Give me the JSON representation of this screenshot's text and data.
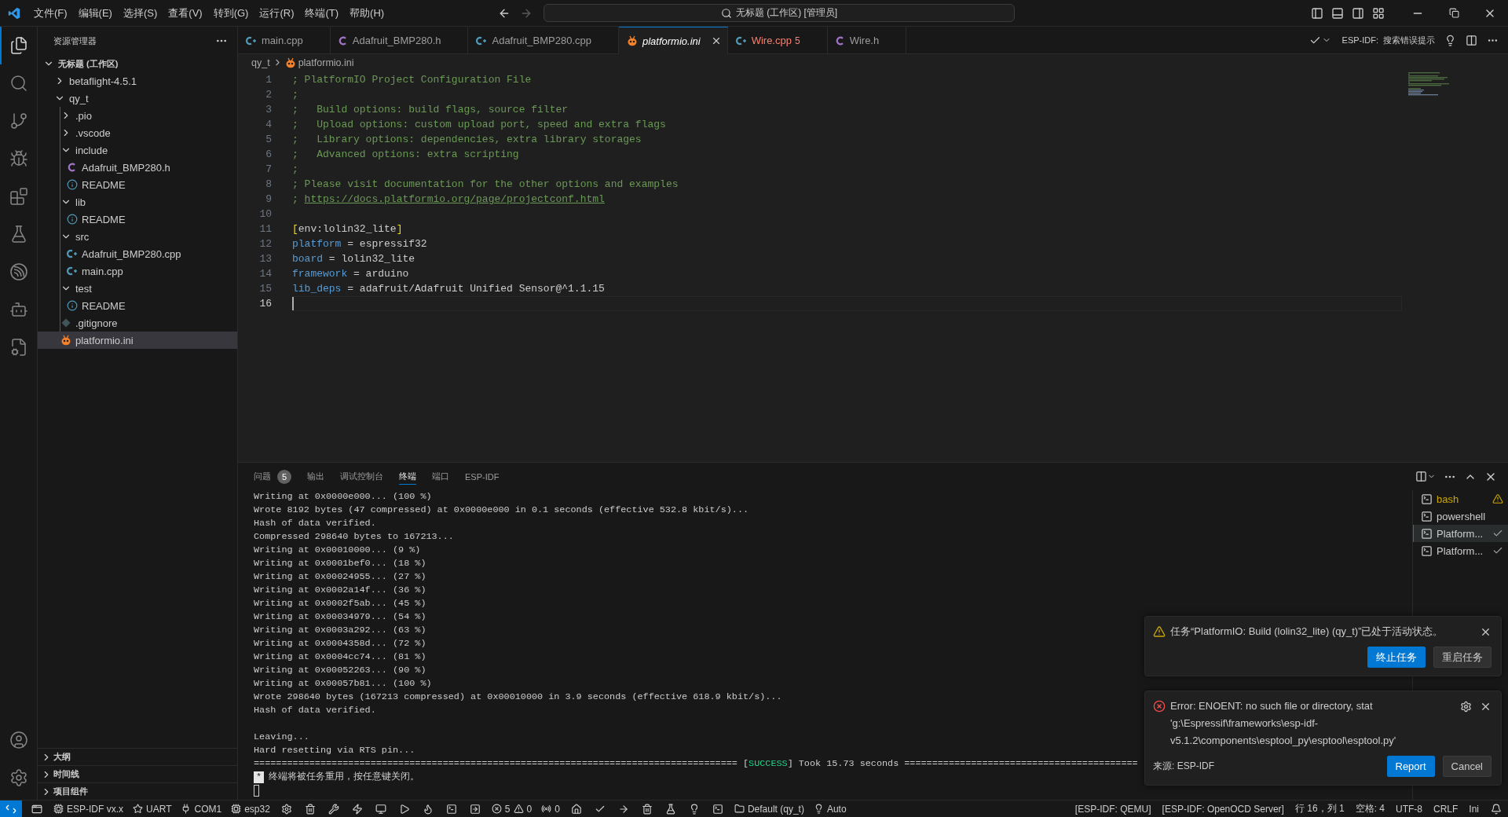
{
  "title_bar": {
    "menus": [
      "文件(F)",
      "编辑(E)",
      "选择(S)",
      "查看(V)",
      "转到(G)",
      "运行(R)",
      "终端(T)",
      "帮助(H)"
    ],
    "search": "无标题 (工作区) [管理员]"
  },
  "activity_bar": [
    {
      "selected": true
    },
    {
      "selected": false
    },
    {
      "selected": false
    },
    {
      "selected": false
    },
    {
      "selected": false
    },
    {
      "selected": false
    },
    {
      "selected": false
    },
    {
      "selected": false
    },
    {
      "selected": false
    }
  ],
  "sidebar": {
    "title": "资源管理器",
    "workspace": {
      "label": "无标题 (工作区)",
      "expanded": true,
      "children": [
        {
          "label": "betaflight-4.5.1",
          "kind": "folder",
          "expanded": false,
          "selected": false
        },
        {
          "label": "qy_t",
          "kind": "folder",
          "expanded": true,
          "selected": false,
          "children": [
            {
              "label": ".pio",
              "kind": "folder",
              "expanded": false,
              "selected": false
            },
            {
              "label": ".vscode",
              "kind": "folder",
              "expanded": false,
              "selected": false
            },
            {
              "label": "include",
              "kind": "folder",
              "expanded": true,
              "selected": false,
              "children": [
                {
                  "label": "Adafruit_BMP280.h",
                  "kind": "c-header",
                  "selected": false
                },
                {
                  "label": "README",
                  "kind": "readme",
                  "selected": false
                }
              ]
            },
            {
              "label": "lib",
              "kind": "folder",
              "expanded": true,
              "selected": false,
              "children": [
                {
                  "label": "README",
                  "kind": "readme",
                  "selected": false
                }
              ]
            },
            {
              "label": "src",
              "kind": "folder",
              "expanded": true,
              "selected": false,
              "children": [
                {
                  "label": "Adafruit_BMP280.cpp",
                  "kind": "cpp",
                  "selected": false
                },
                {
                  "label": "main.cpp",
                  "kind": "cpp",
                  "selected": false
                }
              ]
            },
            {
              "label": "test",
              "kind": "folder",
              "expanded": true,
              "selected": false,
              "children": [
                {
                  "label": "README",
                  "kind": "readme",
                  "selected": false
                }
              ]
            },
            {
              "label": ".gitignore",
              "kind": "git",
              "selected": false
            },
            {
              "label": "platformio.ini",
              "kind": "ini",
              "selected": true
            }
          ]
        }
      ]
    },
    "sections": [
      {
        "label": "大纲",
        "expanded": false
      },
      {
        "label": "时间线",
        "expanded": false
      },
      {
        "label": "项目组件",
        "expanded": false
      }
    ]
  },
  "editor": {
    "tabs": [
      {
        "label": "main.cpp",
        "kind": "cpp",
        "selected": false,
        "preview": false
      },
      {
        "label": "Adafruit_BMP280.h",
        "kind": "c-header",
        "selected": false,
        "preview": false
      },
      {
        "label": "Adafruit_BMP280.cpp",
        "kind": "cpp",
        "selected": false,
        "preview": false
      },
      {
        "label": "platformio.ini",
        "kind": "ini",
        "selected": true,
        "preview": true
      },
      {
        "label": "Wire.cpp",
        "kind": "cpp",
        "selected": false,
        "preview": false,
        "problems": "5"
      },
      {
        "label": "Wire.h",
        "kind": "c-header",
        "selected": false,
        "preview": false
      }
    ],
    "actions": {
      "prefix": "ESP-IDF:",
      "label": "搜索错误提示"
    },
    "breadcrumb": [
      {
        "label": "qy_t",
        "kind": "folder"
      },
      {
        "label": "platformio.ini",
        "kind": "ini"
      }
    ],
    "lines": [
      {
        "number": "1",
        "selected": false,
        "segments": [
          {
            "kind": "comment",
            "text": "; PlatformIO Project Configuration File"
          }
        ]
      },
      {
        "number": "2",
        "selected": false,
        "segments": [
          {
            "kind": "comment",
            "text": ";"
          }
        ]
      },
      {
        "number": "3",
        "selected": false,
        "segments": [
          {
            "kind": "comment",
            "text": ";   Build options: build flags, source filter"
          }
        ]
      },
      {
        "number": "4",
        "selected": false,
        "segments": [
          {
            "kind": "comment",
            "text": ";   Upload options: custom upload port, speed and extra flags"
          }
        ]
      },
      {
        "number": "5",
        "selected": false,
        "segments": [
          {
            "kind": "comment",
            "text": ";   Library options: dependencies, extra library storages"
          }
        ]
      },
      {
        "number": "6",
        "selected": false,
        "segments": [
          {
            "kind": "comment",
            "text": ";   Advanced options: extra scripting"
          }
        ]
      },
      {
        "number": "7",
        "selected": false,
        "segments": [
          {
            "kind": "comment",
            "text": ";"
          }
        ]
      },
      {
        "number": "8",
        "selected": false,
        "segments": [
          {
            "kind": "comment",
            "text": "; Please visit documentation for the other options and examples"
          }
        ]
      },
      {
        "number": "9",
        "selected": false,
        "segments": [
          {
            "kind": "comment",
            "text": "; "
          },
          {
            "kind": "link",
            "text": "https://docs.platformio.org/page/projectconf.html"
          }
        ]
      },
      {
        "number": "10",
        "selected": false
      },
      {
        "number": "11",
        "selected": false,
        "segments": [
          {
            "kind": "bracket",
            "text": "["
          },
          {
            "kind": "plain",
            "text": "env:lolin32_lite"
          },
          {
            "kind": "bracket",
            "text": "]"
          }
        ]
      },
      {
        "number": "12",
        "selected": false,
        "segments": [
          {
            "kind": "key",
            "text": "platform"
          },
          {
            "kind": "plain",
            "text": " = espressif32"
          }
        ]
      },
      {
        "number": "13",
        "selected": false,
        "segments": [
          {
            "kind": "key",
            "text": "board"
          },
          {
            "kind": "plain",
            "text": " = lolin32_lite"
          }
        ]
      },
      {
        "number": "14",
        "selected": false,
        "segments": [
          {
            "kind": "key",
            "text": "framework"
          },
          {
            "kind": "plain",
            "text": " = arduino"
          }
        ]
      },
      {
        "number": "15",
        "selected": false,
        "segments": [
          {
            "kind": "key",
            "text": "lib_deps"
          },
          {
            "kind": "plain",
            "text": " = adafruit/Adafruit Unified Sensor@^1.1.15"
          }
        ]
      },
      {
        "number": "16",
        "selected": true
      }
    ]
  },
  "panel": {
    "tabs": [
      {
        "label": "问题",
        "badge": "5",
        "selected": false
      },
      {
        "label": "输出",
        "selected": false
      },
      {
        "label": "调试控制台",
        "selected": false
      },
      {
        "label": "终端",
        "selected": true
      },
      {
        "label": "端口",
        "selected": false
      },
      {
        "label": "ESP-IDF",
        "selected": false
      }
    ],
    "terminal": {
      "lines": [
        {
          "kind": "text",
          "text": "Writing at 0x0000e000... (100 %)"
        },
        {
          "kind": "text",
          "text": "Wrote 8192 bytes (47 compressed) at 0x0000e000 in 0.1 seconds (effective 532.8 kbit/s)..."
        },
        {
          "kind": "text",
          "text": "Hash of data verified."
        },
        {
          "kind": "text",
          "text": "Compressed 298640 bytes to 167213..."
        },
        {
          "kind": "text",
          "text": "Writing at 0x00010000... (9 %)"
        },
        {
          "kind": "text",
          "text": "Writing at 0x0001bef0... (18 %)"
        },
        {
          "kind": "text",
          "text": "Writing at 0x00024955... (27 %)"
        },
        {
          "kind": "text",
          "text": "Writing at 0x0002a14f... (36 %)"
        },
        {
          "kind": "text",
          "text": "Writing at 0x0002f5ab... (45 %)"
        },
        {
          "kind": "text",
          "text": "Writing at 0x00034979... (54 %)"
        },
        {
          "kind": "text",
          "text": "Writing at 0x0003a292... (63 %)"
        },
        {
          "kind": "text",
          "text": "Writing at 0x0004358d... (72 %)"
        },
        {
          "kind": "text",
          "text": "Writing at 0x0004cc74... (81 %)"
        },
        {
          "kind": "text",
          "text": "Writing at 0x00052263... (90 %)"
        },
        {
          "kind": "text",
          "text": "Writing at 0x00057b81... (100 %)"
        },
        {
          "kind": "text",
          "text": "Wrote 298640 bytes (167213 compressed) at 0x00010000 in 3.9 seconds (effective 618.9 kbit/s)..."
        },
        {
          "kind": "text",
          "text": "Hash of data verified."
        },
        {
          "kind": "blank"
        },
        {
          "kind": "text",
          "text": "Leaving..."
        },
        {
          "kind": "text",
          "text": "Hard resetting via RTS pin..."
        },
        {
          "kind": "status",
          "before": "======================================================================================= [",
          "status": "SUCCESS",
          "after": "] Took 15.73 seconds =========================================="
        },
        {
          "kind": "notice",
          "mark": "*",
          "text": "终端将被任务重用，按任意键关闭。"
        },
        {
          "kind": "cursor"
        }
      ]
    },
    "terminals": [
      {
        "label": "bash",
        "kind": "warning",
        "selected": false
      },
      {
        "label": "powershell",
        "kind": "plain",
        "selected": false
      },
      {
        "label": "Platform...",
        "kind": "success",
        "selected": true
      },
      {
        "label": "Platform...",
        "kind": "success",
        "selected": false
      }
    ]
  },
  "notifications": [
    {
      "kind": "warning",
      "message": "任务“PlatformIO: Build (lolin32_lite) (qy_t)”已处于活动状态。",
      "buttons": [
        {
          "label": "终止任务",
          "primary": true
        },
        {
          "label": "重启任务",
          "primary": false
        }
      ]
    },
    {
      "kind": "error",
      "message": "Error: ENOENT: no such file or directory, stat 'g:\\Espressif\\frameworks\\esp-idf-v5.1.2\\components\\esptool_py\\esptool\\esptool.py'",
      "source": "来源: ESP-IDF",
      "buttons": [
        {
          "label": "Report",
          "primary": true
        },
        {
          "label": "Cancel",
          "primary": false
        }
      ]
    }
  ],
  "status_bar": {
    "idf_version": "ESP-IDF vx.x",
    "uart": "UART",
    "port": "COM1",
    "target": "esp32",
    "errors": "5",
    "warnings": "0",
    "device_count": "0",
    "project": "Default (qy_t)",
    "mode": "Auto",
    "right": [
      "[ESP-IDF: QEMU]",
      "[ESP-IDF: OpenOCD Server]",
      "行 16，列 1",
      "空格: 4",
      "UTF-8",
      "CRLF",
      "Ini"
    ]
  }
}
